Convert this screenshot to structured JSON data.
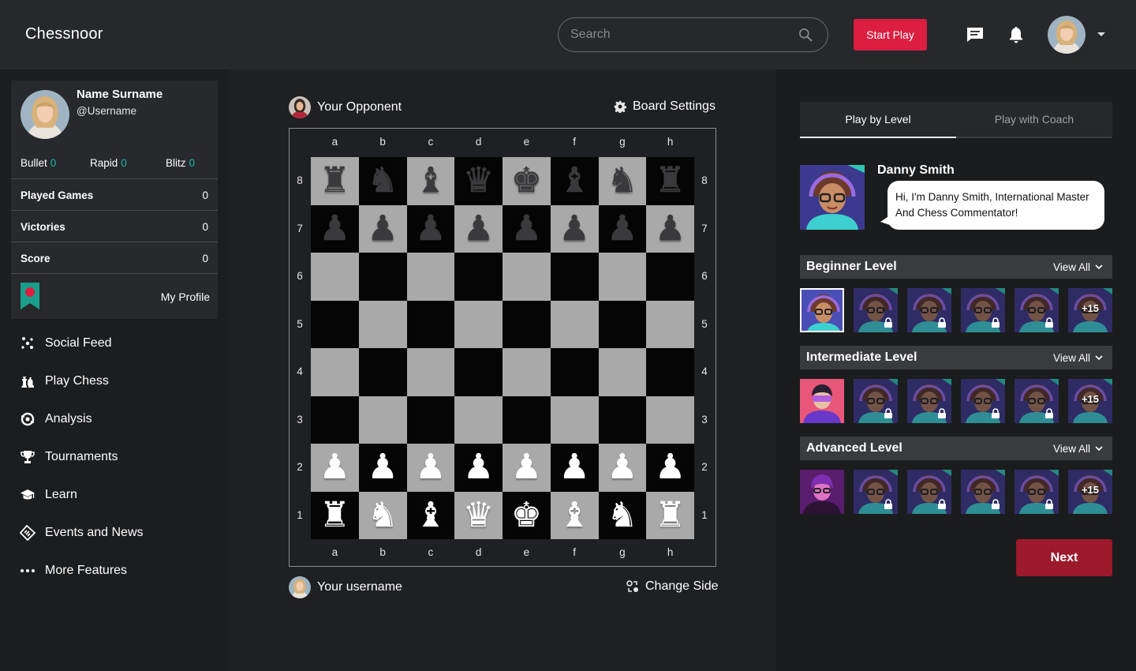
{
  "header": {
    "brand": "Chessnoor",
    "search_placeholder": "Search",
    "start_play_label": "Start Play",
    "icons": [
      "chat-icon",
      "bell-icon",
      "avatar",
      "caret-down-icon"
    ]
  },
  "profile": {
    "name": "Name Surname",
    "username": "@Username",
    "modes": [
      {
        "label": "Bullet",
        "value": "0"
      },
      {
        "label": "Rapid",
        "value": "0"
      },
      {
        "label": "Blitz",
        "value": "0"
      }
    ],
    "stats": [
      {
        "label": "Played Games",
        "value": "0"
      },
      {
        "label": "Victories",
        "value": "0"
      },
      {
        "label": "Score",
        "value": "0"
      }
    ],
    "my_profile_label": "My Profile"
  },
  "nav": [
    {
      "label": "Social Feed",
      "icon": "social-feed-icon"
    },
    {
      "label": "Play Chess",
      "icon": "play-chess-icon"
    },
    {
      "label": "Analysis",
      "icon": "analysis-icon"
    },
    {
      "label": "Tournaments",
      "icon": "trophy-icon"
    },
    {
      "label": "Learn",
      "icon": "graduation-cap-icon"
    },
    {
      "label": "Events and News",
      "icon": "newspaper-icon"
    },
    {
      "label": "More Features",
      "icon": "more-dots-icon"
    }
  ],
  "game": {
    "opponent_label": "Your Opponent",
    "board_settings_label": "Board Settings",
    "you_label": "Your username",
    "change_side_label": "Change Side",
    "files": [
      "a",
      "b",
      "c",
      "d",
      "e",
      "f",
      "g",
      "h"
    ],
    "ranks": [
      "8",
      "7",
      "6",
      "5",
      "4",
      "3",
      "2",
      "1"
    ],
    "position": [
      [
        "bR",
        "bN",
        "bB",
        "bQ",
        "bK",
        "bB",
        "bN",
        "bR"
      ],
      [
        "bP",
        "bP",
        "bP",
        "bP",
        "bP",
        "bP",
        "bP",
        "bP"
      ],
      [
        "",
        "",
        "",
        "",
        "",
        "",
        "",
        ""
      ],
      [
        "",
        "",
        "",
        "",
        "",
        "",
        "",
        ""
      ],
      [
        "",
        "",
        "",
        "",
        "",
        "",
        "",
        ""
      ],
      [
        "",
        "",
        "",
        "",
        "",
        "",
        "",
        ""
      ],
      [
        "wP",
        "wP",
        "wP",
        "wP",
        "wP",
        "wP",
        "wP",
        "wP"
      ],
      [
        "wR",
        "wN",
        "wB",
        "wQ",
        "wK",
        "wB",
        "wN",
        "wR"
      ]
    ],
    "colors": {
      "light_square": "#a9a9a9",
      "dark_square": "#050505"
    }
  },
  "right": {
    "tabs": [
      {
        "label": "Play by Level",
        "active": true
      },
      {
        "label": "Play with Coach",
        "active": false
      }
    ],
    "coach": {
      "name": "Danny Smith",
      "message": "Hi, I'm Danny Smith, International Master And Chess  Commentator!"
    },
    "levels": [
      {
        "title": "Beginner Level",
        "view_all": "View All",
        "more": "+15"
      },
      {
        "title": "Intermediate Level",
        "view_all": "View All",
        "more": "+15"
      },
      {
        "title": "Advanced Level",
        "view_all": "View All",
        "more": "+15"
      }
    ],
    "next_label": "Next"
  },
  "colors": {
    "accent": "#dc1e41",
    "next": "#9c1a2c",
    "teal": "#1fb8a8"
  }
}
